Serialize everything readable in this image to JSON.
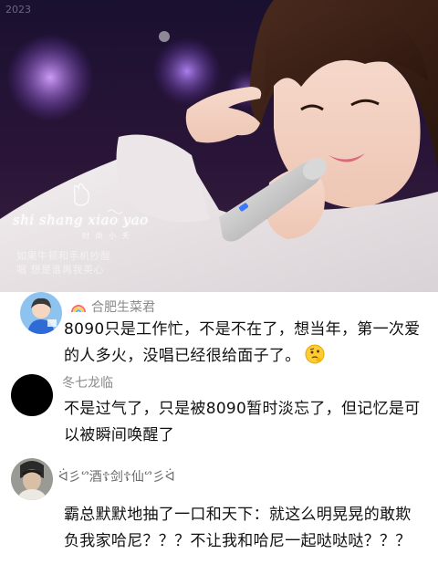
{
  "video": {
    "corner_text": "2023",
    "watermark": "shi shang xiao yao",
    "watermark_sub": "时 尚 小 夭",
    "caption_line1": "如果牛顿和手机抄醒",
    "caption_line2": "唱 想是谁再我英心"
  },
  "comments": [
    {
      "username": "合肥生菜君",
      "text": "8090只是工作忙，不是不在了，想当年，第一次爱的人多火，没唱已经很给面子了。",
      "emoji": "thinking-face-icon"
    },
    {
      "username": "冬七龙临",
      "text": "不是过气了，只是被8090暂时淡忘了，但记忆是可以被瞬间唤醒了"
    },
    {
      "username": "ᐛ彡ᔥ酒☦剑☦仙ᔥ彡ᐛ",
      "text": "霸总默默地抽了一口和天下：就这么明晃晃的敢欺负我家哈尼？？？不让我和哈尼一起哒哒哒？？？"
    }
  ]
}
